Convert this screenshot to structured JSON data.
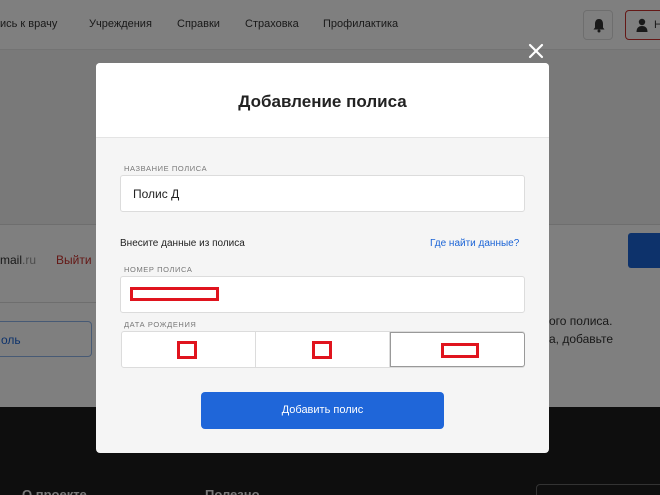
{
  "nav": {
    "items": [
      "ись к врачу",
      "Учреждения",
      "Справки",
      "Страховка",
      "Профилактика"
    ],
    "user_label": "Н"
  },
  "background": {
    "email_prefix": "mail",
    "email_suffix": ".ru",
    "logout_label": "Выйти",
    "password_button_label": "оль",
    "info_lines": [
      "ого полиса.",
      "а, добавьте"
    ],
    "footer_items": [
      "О проекте",
      "Полезно"
    ]
  },
  "modal": {
    "title": "Добавление полиса",
    "policy_name": {
      "label": "НАЗВАНИЕ ПОЛИСА",
      "value": "Полис Д"
    },
    "hint_text": "Внесите данные из полиса",
    "help_link": "Где найти данные?",
    "policy_number": {
      "label": "НОМЕР ПОЛИСА",
      "value": ""
    },
    "birth_date": {
      "label": "ДАТА РОЖДЕНИЯ",
      "day": "",
      "month": "",
      "year": ""
    },
    "submit_label": "Добавить полис"
  },
  "icons": {
    "close": "close-icon",
    "bell": "bell-icon",
    "user": "user-icon"
  },
  "colors": {
    "primary": "#1f66d9",
    "danger": "#c9302c",
    "redaction": "#e0141e"
  }
}
